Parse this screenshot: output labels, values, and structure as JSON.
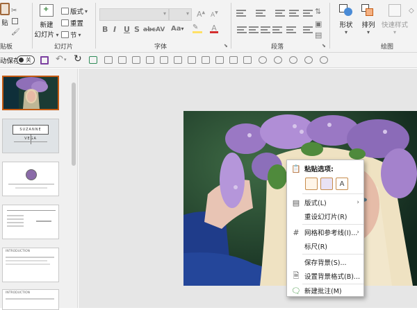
{
  "ribbon": {
    "paste_label": "贴",
    "new_slide_label": "新建",
    "new_slide_label2": "幻灯片",
    "layout_label": "版式",
    "reset_label": "重置",
    "section_label": "节",
    "group_clipboard": "贴板",
    "group_slides": "幻灯片",
    "group_font": "字体",
    "group_paragraph": "段落",
    "group_drawing": "绘图",
    "font_size_btn": "Aa",
    "shape_label": "形状",
    "arrange_label": "排列",
    "quick_style_label": "快速样式"
  },
  "qat": {
    "autosave_label": "动保存",
    "toggle_label": "关"
  },
  "thumbs": {
    "slide2_title": "SUZANNE VEGA",
    "slide5_title": "INTRODUCTION",
    "slide6_title": "INTRODUCTION"
  },
  "menu": {
    "paste_options": "粘贴选项:",
    "layout": "版式(L)",
    "reset_slide": "重设幻灯片(R)",
    "grid_guides": "网格和参考线(I)...",
    "ruler": "标尺(R)",
    "save_background": "保存背景(S)...",
    "format_background": "设置背景格式(B)...",
    "new_comment": "新建批注(M)"
  },
  "colors": {
    "accent": "#c55a11",
    "ribbon_bg": "#f3f3f3",
    "canvas_bg": "#e6e6e6"
  }
}
